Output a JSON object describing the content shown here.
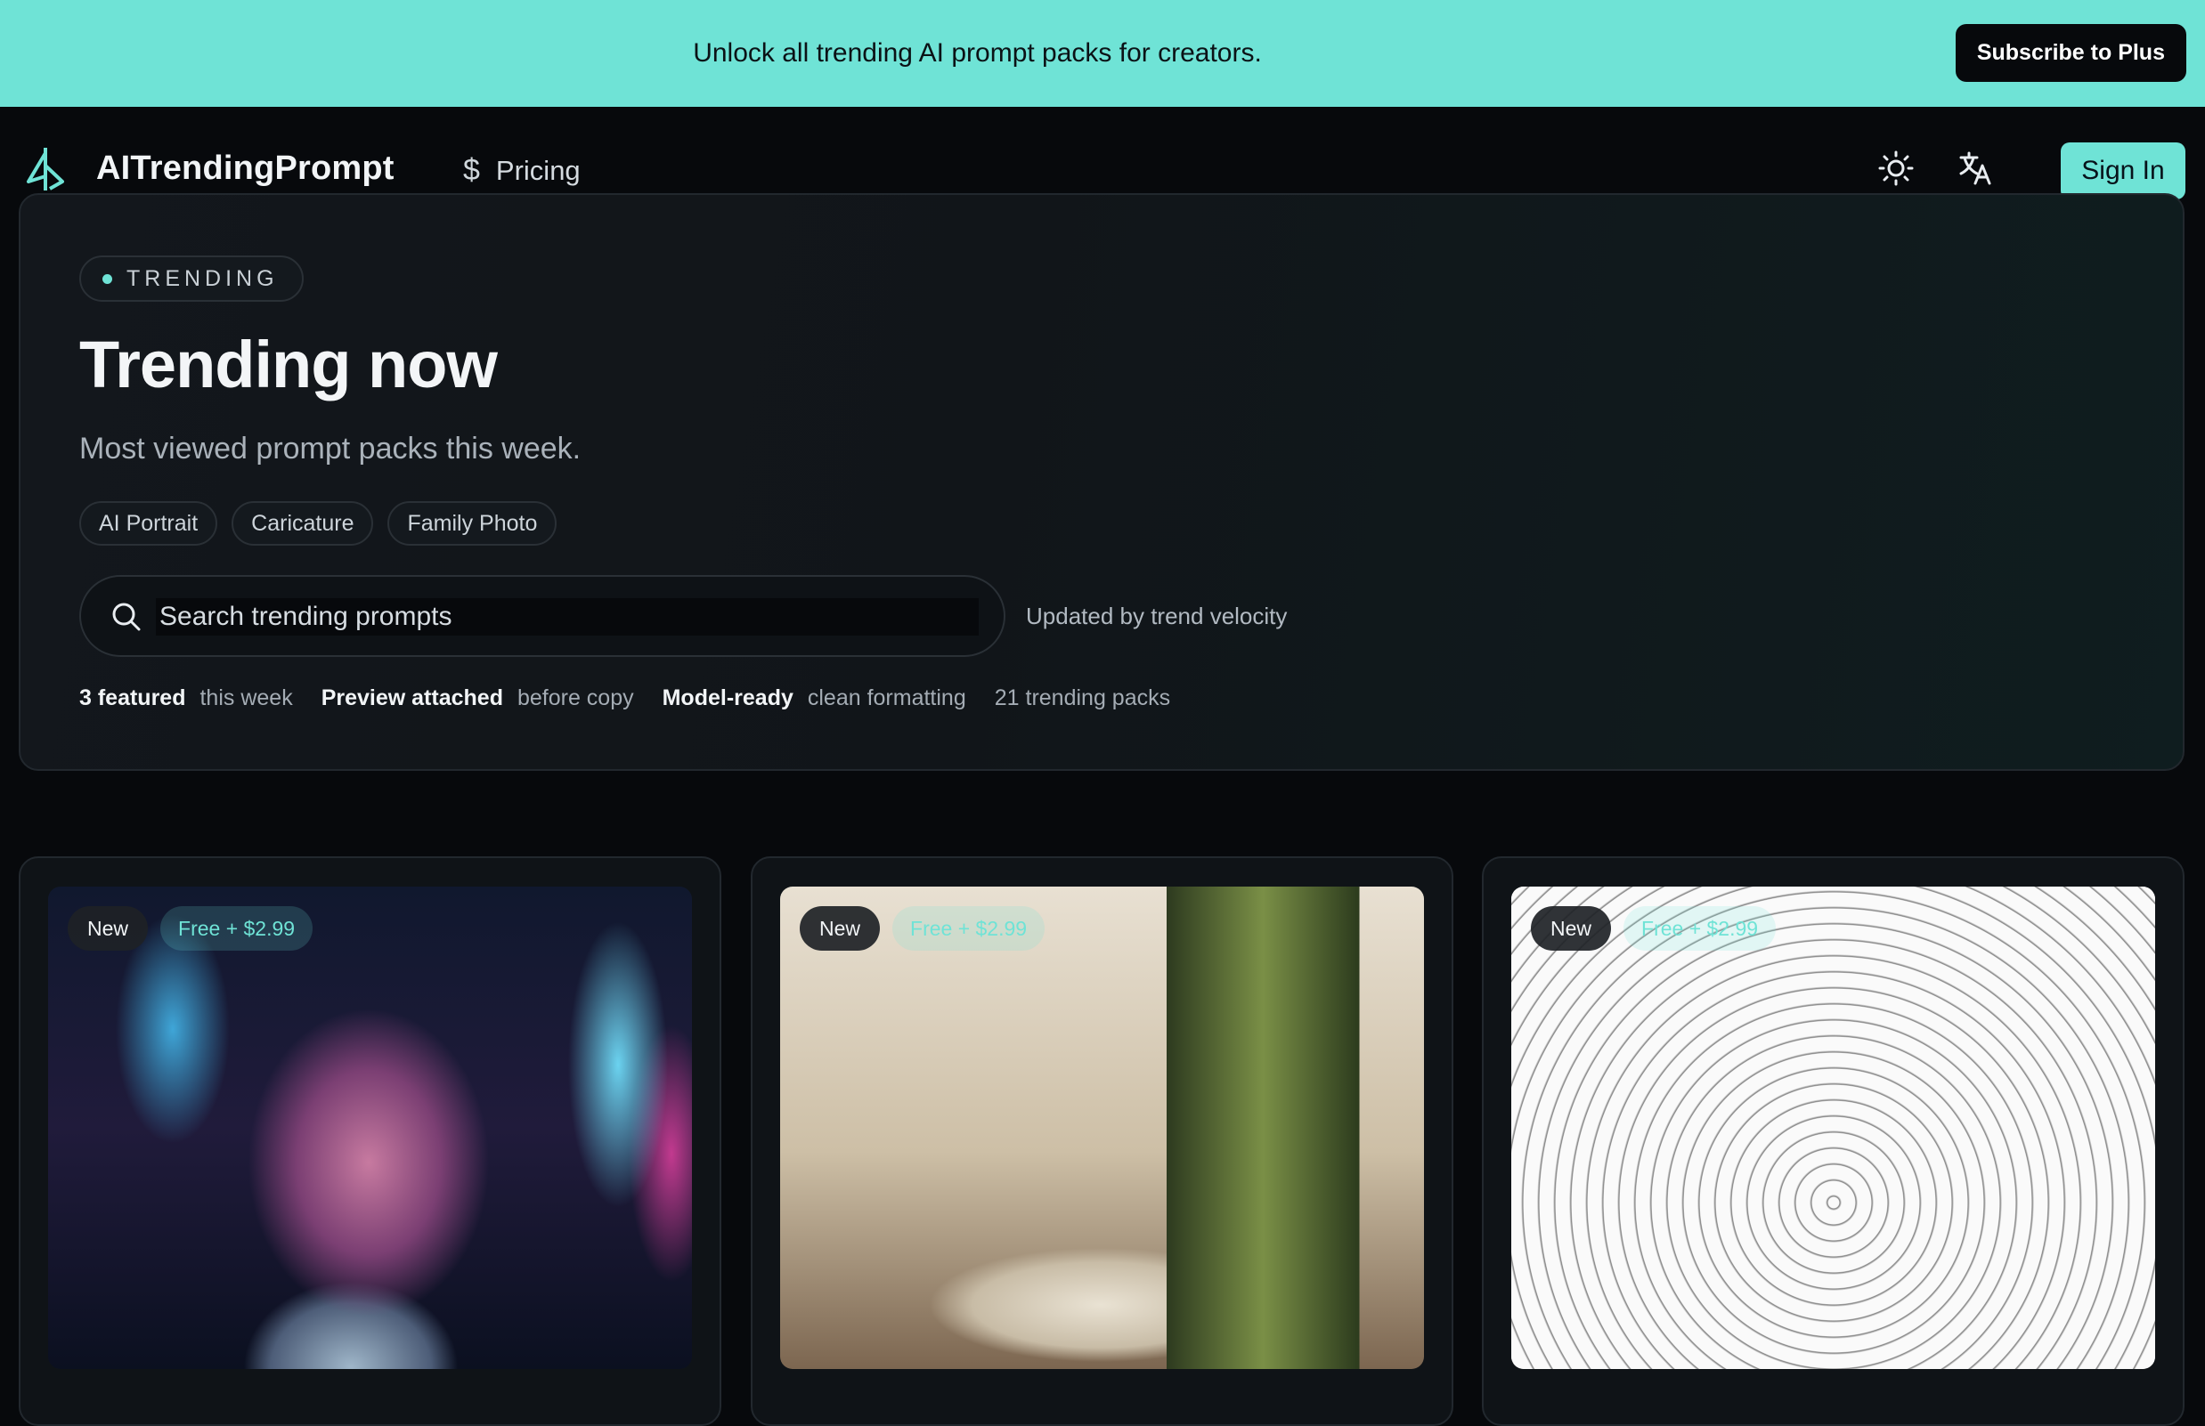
{
  "promo": {
    "text": "Unlock all trending AI prompt packs for creators.",
    "cta": "Subscribe to Plus"
  },
  "header": {
    "brand": "AITrendingPrompt",
    "nav": {
      "pricing": "Pricing"
    },
    "sign_in": "Sign In",
    "icons": [
      "logo-icon",
      "dollar-icon",
      "sun-icon",
      "translate-icon"
    ]
  },
  "hero": {
    "pill": "TRENDING",
    "title": "Trending now",
    "subtitle": "Most viewed prompt packs this week.",
    "tags": [
      "AI Portrait",
      "Caricature",
      "Family Photo"
    ],
    "search": {
      "placeholder": "Search trending prompts",
      "value": ""
    },
    "updated_note": "Updated by trend velocity",
    "stats": [
      {
        "key": "3 featured",
        "value": "this week"
      },
      {
        "key": "Preview attached",
        "value": "before copy"
      },
      {
        "key": "Model-ready",
        "value": "clean formatting"
      }
    ],
    "count_text": "21 trending packs"
  },
  "cards": [
    {
      "badge": "New",
      "price": "Free + $2.99",
      "image": "neon city portrait"
    },
    {
      "badge": "New",
      "price": "Free + $2.99",
      "image": "modern interior living room"
    },
    {
      "badge": "New",
      "price": "Free + $2.99",
      "image": "mandala coloring page"
    }
  ],
  "colors": {
    "accent": "#6fe3d6",
    "background": "#07090c",
    "panel": "#13171c"
  }
}
